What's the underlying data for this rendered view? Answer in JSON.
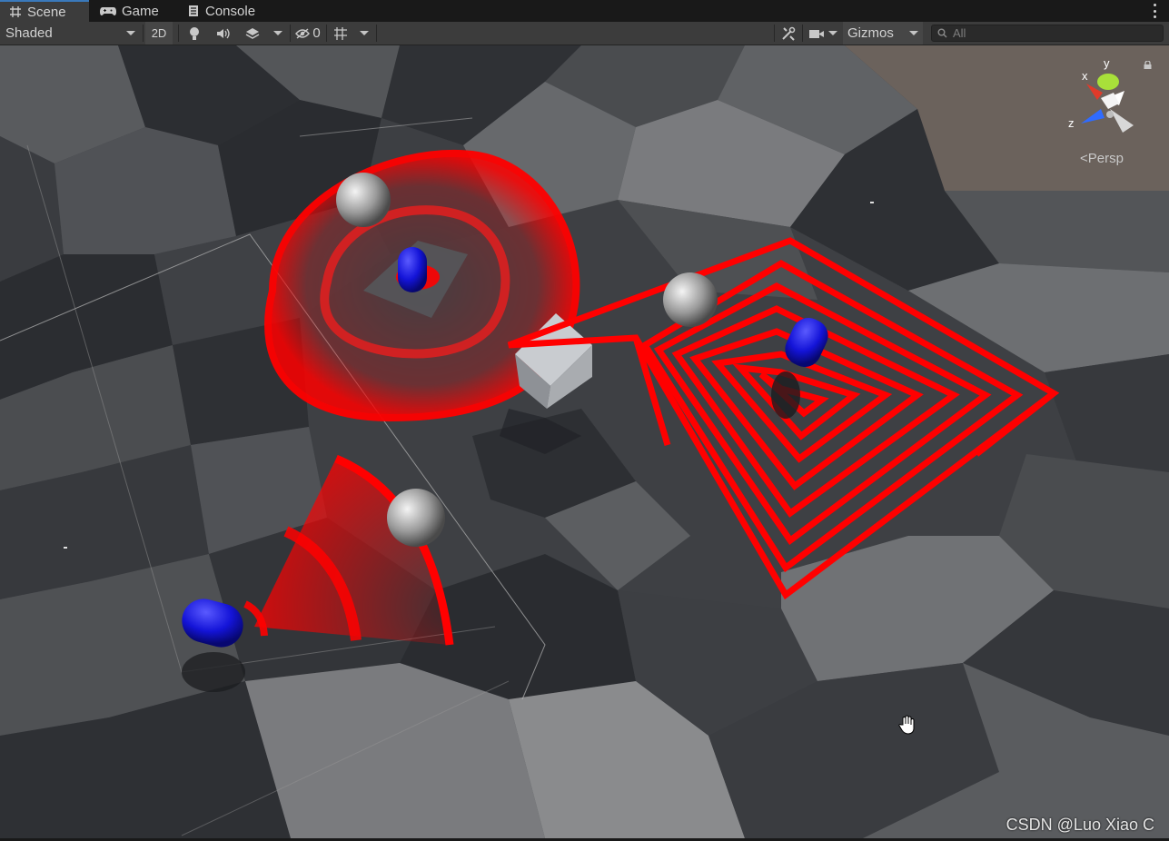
{
  "tabs": [
    {
      "label": "Scene",
      "icon": "grid-icon",
      "active": true
    },
    {
      "label": "Game",
      "icon": "gamepad-icon",
      "active": false
    },
    {
      "label": "Console",
      "icon": "console-icon",
      "active": false
    }
  ],
  "toolbar": {
    "draw_mode": "Shaded",
    "mode_2d": "2D",
    "hidden_count": "0",
    "gizmos_label": "Gizmos",
    "search_placeholder": "All"
  },
  "scene": {
    "projection_label": "Persp",
    "axis_x": "x",
    "axis_y": "y",
    "axis_z": "z",
    "watermark": "CSDN @Luo Xiao C",
    "colors": {
      "detection_zone": "#ff0000",
      "agent": "#1515e0",
      "floor_dark": "#34363a",
      "floor_light": "#76777a"
    }
  }
}
